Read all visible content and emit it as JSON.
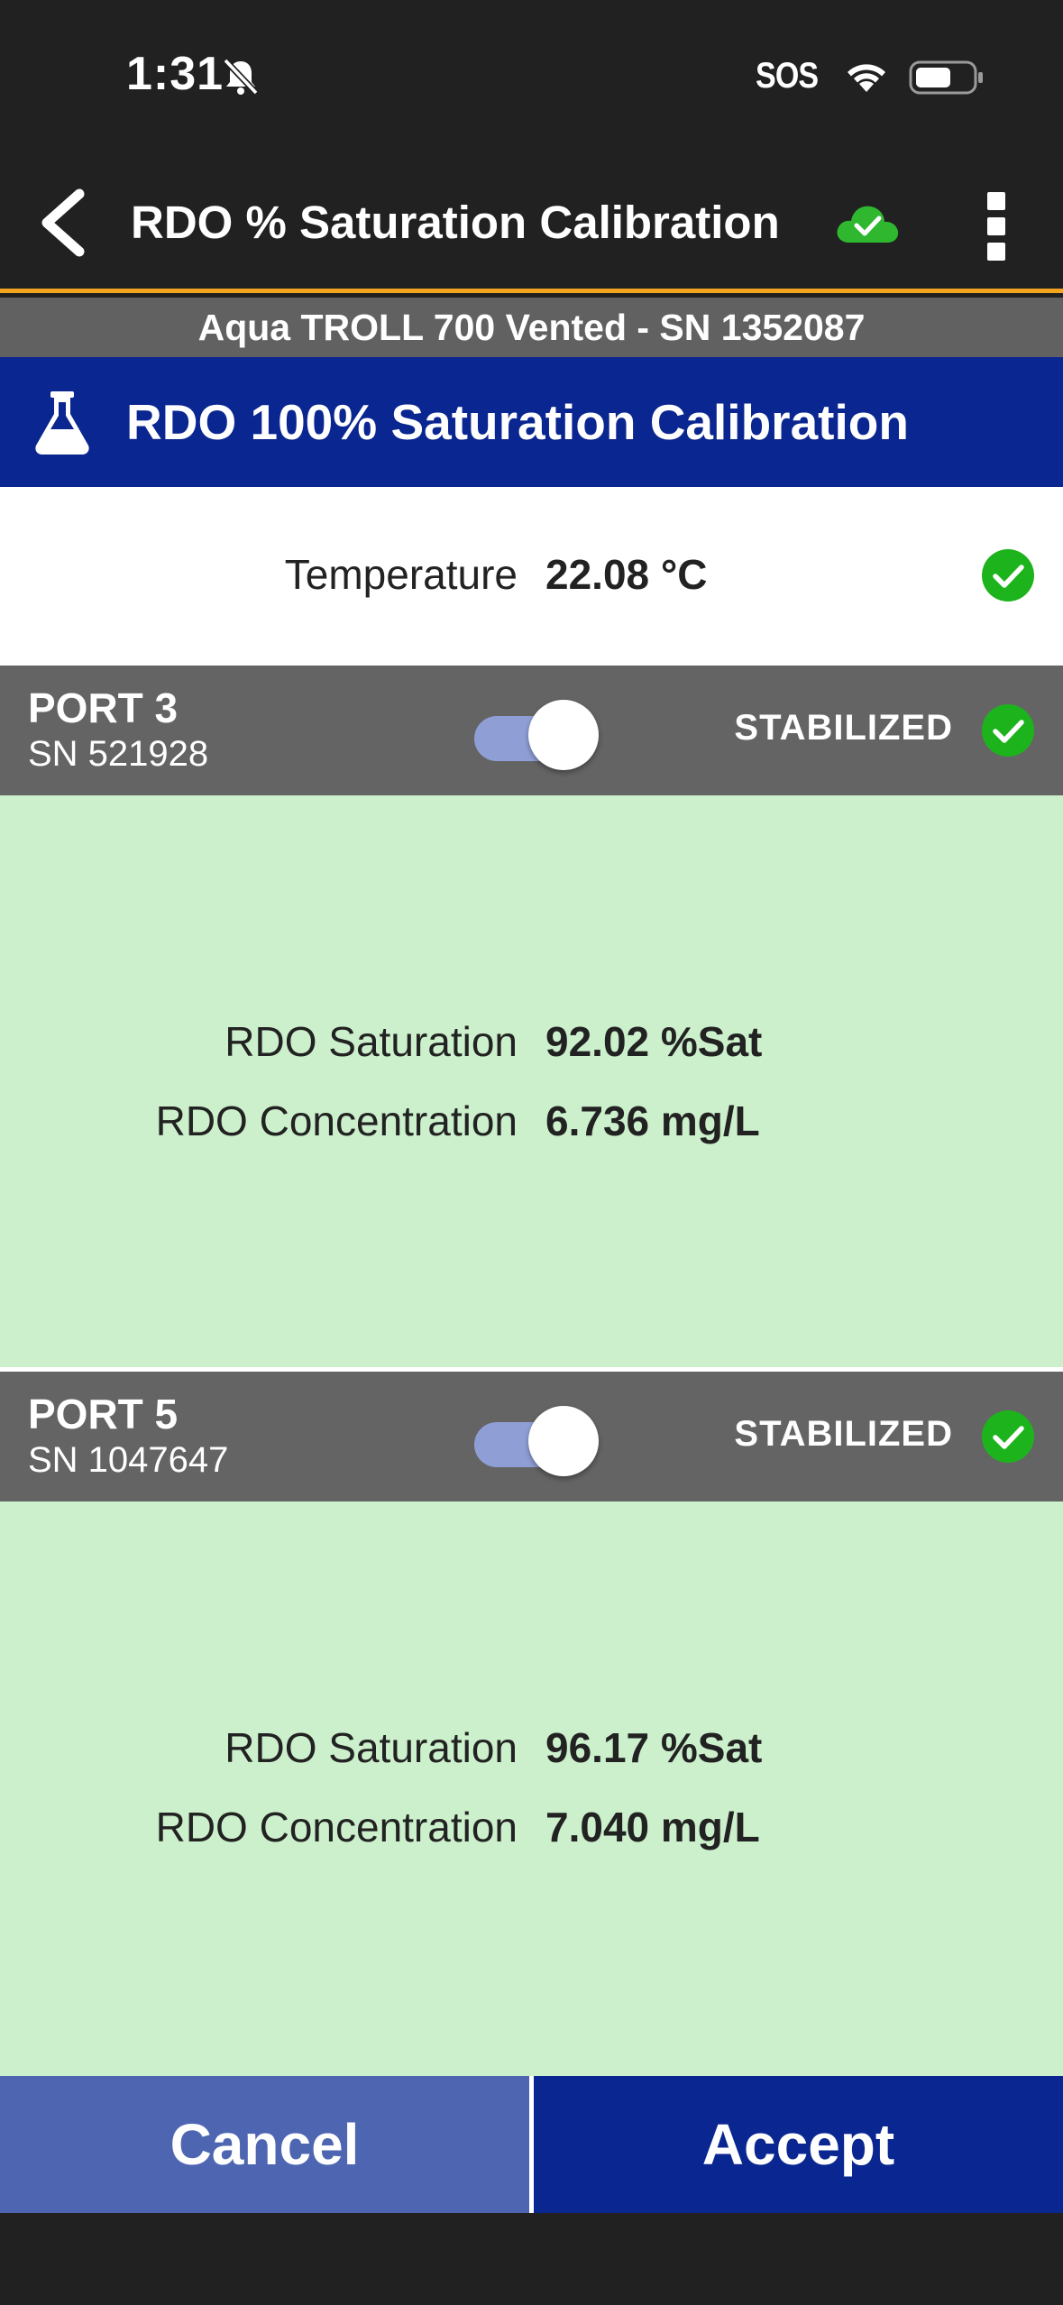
{
  "status_bar": {
    "time": "1:31",
    "sos": "SOS",
    "icons": [
      "bell-muted-icon",
      "wifi-icon",
      "battery-icon"
    ]
  },
  "app_bar": {
    "title": "RDO % Saturation Calibration",
    "icons": [
      "back-chevron-icon",
      "cloud-check-icon",
      "more-vertical-icon"
    ],
    "accent_color": "#f3a51d"
  },
  "device": {
    "label": "Aqua TROLL 700 Vented - SN 1352087"
  },
  "calibration": {
    "title": "RDO 100% Saturation Calibration",
    "icon": "flask-icon",
    "header_color": "#0a2691"
  },
  "temperature": {
    "label": "Temperature",
    "value": "22.08 °C",
    "ok": true
  },
  "ports": [
    {
      "name": "PORT 3",
      "sn": "SN 521928",
      "enabled": true,
      "status": "STABILIZED",
      "readings": [
        {
          "label": "RDO Saturation",
          "value": "92.02 %Sat"
        },
        {
          "label": "RDO Concentration",
          "value": "6.736 mg/L"
        }
      ]
    },
    {
      "name": "PORT 5",
      "sn": "SN 1047647",
      "enabled": true,
      "status": "STABILIZED",
      "readings": [
        {
          "label": "RDO Saturation",
          "value": "96.17 %Sat"
        },
        {
          "label": "RDO Concentration",
          "value": "7.040 mg/L"
        }
      ]
    }
  ],
  "buttons": {
    "cancel": "Cancel",
    "accept": "Accept"
  },
  "colors": {
    "success_green": "#1db31d",
    "port_body_bg": "#ccf0cc",
    "cancel_bg": "#4e66b2",
    "accept_bg": "#0a2691"
  }
}
